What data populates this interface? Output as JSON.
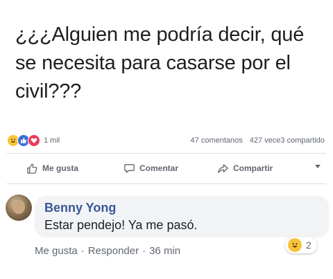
{
  "post": {
    "text": "¿¿¿Alguien me podría decir, qué se necesita para casarse por el civil???",
    "reactions": {
      "icons": [
        "haha-icon",
        "like-icon",
        "love-icon"
      ],
      "count": "1 mil"
    },
    "comments_count": "47 comentanos",
    "shares_count": "427 vece3 compartido"
  },
  "actions": {
    "like": "Me gusta",
    "comment": "Comentar",
    "share": "Compartir"
  },
  "comment": {
    "author": "Benny Yong",
    "text": "Estar pendejo! Ya me pasó.",
    "like_label": "Me gusta",
    "separator": "·",
    "reply_label": "Responder",
    "time": "36 min",
    "reaction_count": "2"
  },
  "colors": {
    "link_blue": "#385898",
    "meta_gray": "#606770",
    "bubble_bg": "#f2f3f5",
    "haha_yellow": "#f7c33b",
    "like_blue": "#3b6fd8",
    "love_red": "#e9395b"
  }
}
